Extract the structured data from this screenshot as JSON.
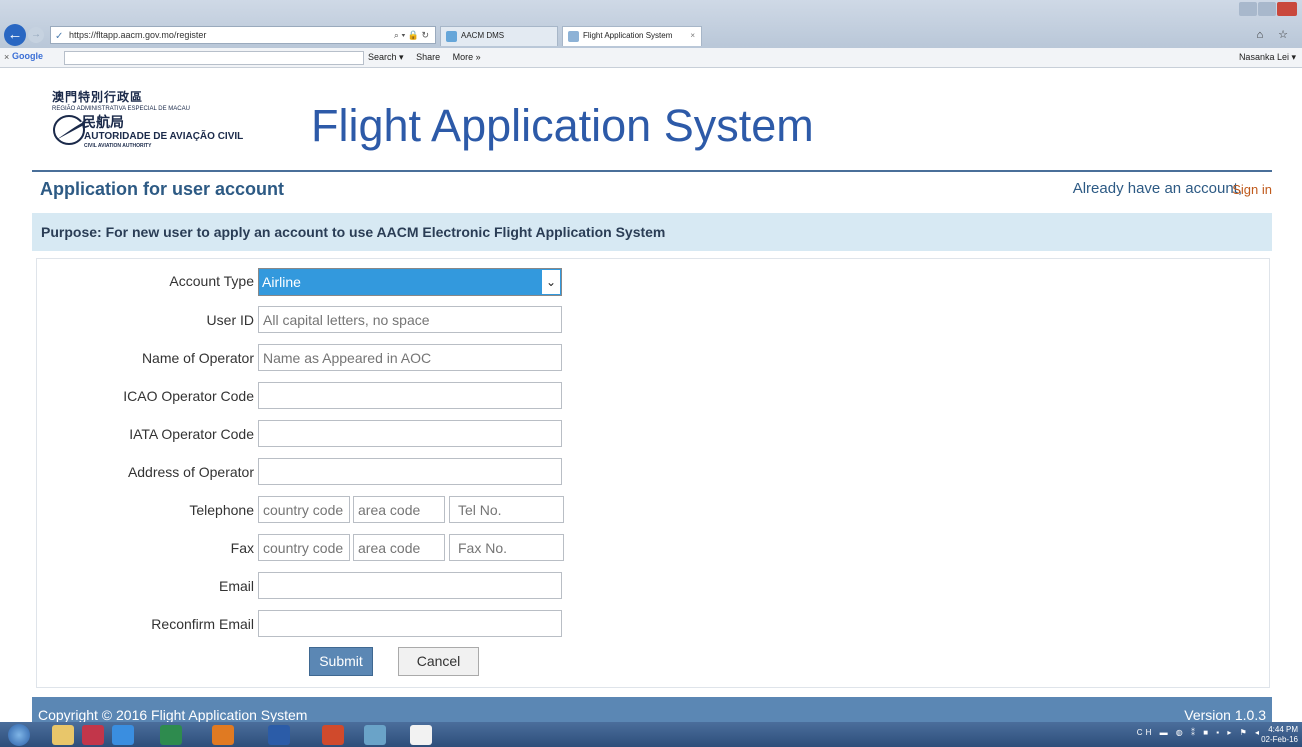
{
  "browser": {
    "url": "https://fltapp.aacm.gov.mo/register",
    "tabs": [
      {
        "label": "AACM DMS"
      },
      {
        "label": "Flight Application System"
      }
    ],
    "toolbar": {
      "google": "Google",
      "search": "Search ▾",
      "share": "Share",
      "more": "More »",
      "user": "Nasanka Lei ▾"
    }
  },
  "header": {
    "logo_cn": "澳門特別行政區",
    "logo_pt": "REGIÃO ADMINISTRATIVA ESPECIAL DE MACAU",
    "logo_cn2": "民航局",
    "logo_pt2": "AUTORIDADE DE AVIAÇÃO CIVIL",
    "logo_en": "CIVIL AVIATION AUTHORITY",
    "app_title": "Flight Application System"
  },
  "section": {
    "title": "Application for user account",
    "signin_text": "Already have an account,",
    "signin_link": "Sign in",
    "purpose": "Purpose: For new user to apply an account to use AACM Electronic Flight Application System"
  },
  "form": {
    "account_type_label": "Account Type",
    "account_type_value": "Airline",
    "user_id_label": "User ID",
    "user_id_placeholder": "All capital letters, no space",
    "operator_name_label": "Name of Operator",
    "operator_name_placeholder": "Name as Appeared in AOC",
    "icao_label": "ICAO Operator Code",
    "iata_label": "IATA Operator Code",
    "address_label": "Address of Operator",
    "telephone_label": "Telephone",
    "fax_label": "Fax",
    "country_code_placeholder": "country code",
    "area_code_placeholder": "area code",
    "tel_no_placeholder": "Tel No.",
    "fax_no_placeholder": "Fax No.",
    "email_label": "Email",
    "reconfirm_email_label": "Reconfirm Email",
    "submit": "Submit",
    "cancel": "Cancel"
  },
  "footer": {
    "copyright": "Copyright © 2016 Flight Application System",
    "version": "Version 1.0.3"
  },
  "taskbar": {
    "time": "4:44 PM",
    "date": "02-Feb-16",
    "tray_lang": "CH"
  }
}
